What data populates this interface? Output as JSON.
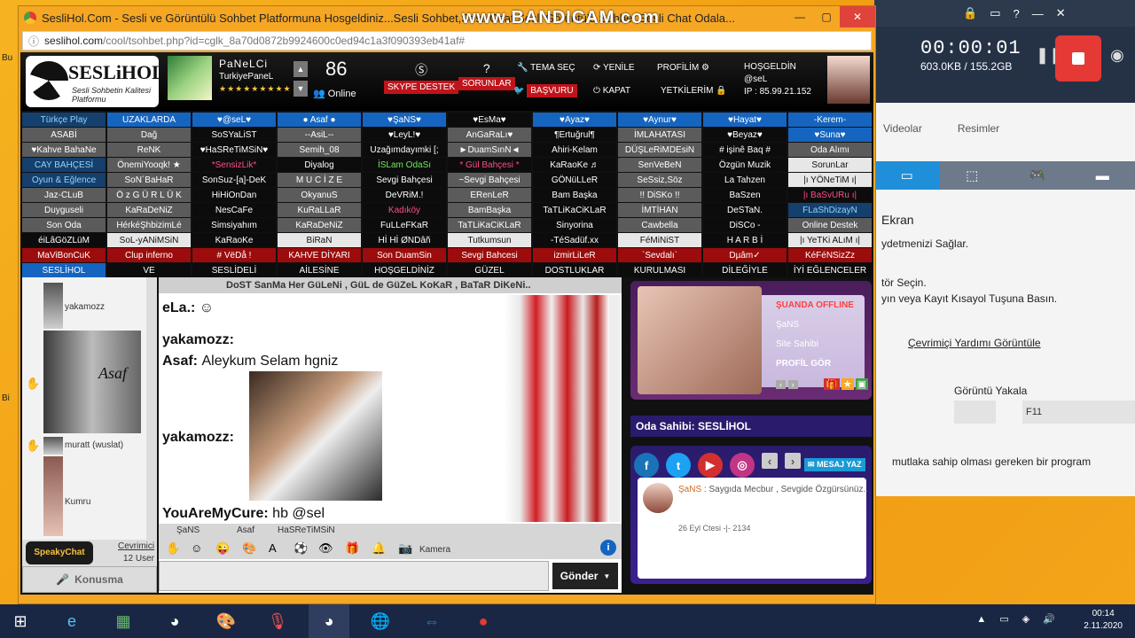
{
  "window": {
    "title": "SesliHol.Com - Sesli ve Görüntülü Sohbet Platformuna Hosgeldiniz...Sesli Sohbet,Sesli Chat,Sesli Görüntülü Sohbet,Sesli Chat Odala...",
    "watermark": "www.BANDICAM.com",
    "url_host": "seslihol.com",
    "url_path": "/cool/tsohbet.php?id=cglk_8a70d0872b9924600c0ed94c1a3f090393eb41af#"
  },
  "header": {
    "logo_title": "SESLiHOL",
    "logo_sub": "Sesli Sohbetin Kalitesi Platformu",
    "user_name": "PaNeLCi",
    "user_rank": "TurkiyePaneL",
    "user_stars": "★★★★★★★★★",
    "online_count": "86",
    "online_label": "Online",
    "skype": "SKYPE DESTEK",
    "sorunlar": "SORUNLAR",
    "tema": "TEMA SEÇ",
    "basvuru": "BAŞVURU",
    "yenile": "YENİLE",
    "kapat": "KAPAT",
    "profilim": "PROFİLİM",
    "yetkilerim": "YETKİLERİM",
    "hosgeldin": "HOŞGELDİN",
    "hosgeldin_user": "@seL",
    "ip": "IP : 85.99.21.152"
  },
  "rooms": [
    {
      "t": "Türkçe Play",
      "c": "teal"
    },
    {
      "t": "UZAKLARDA",
      "c": "blue"
    },
    {
      "t": "♥@seL♥",
      "c": "blue"
    },
    {
      "t": "● Asaf ●",
      "c": "blue"
    },
    {
      "t": "♥ŞaNS♥",
      "c": "blue"
    },
    {
      "t": "♥EsMa♥",
      "c": "dark"
    },
    {
      "t": "♥Ayaz♥",
      "c": "blue"
    },
    {
      "t": "♥Aynur♥",
      "c": "blue"
    },
    {
      "t": "♥Hayat♥",
      "c": "blue"
    },
    {
      "t": "-Kerem-",
      "c": "blue"
    },
    {
      "t": "ASABİ",
      "c": "gray"
    },
    {
      "t": "Dağ",
      "c": "gray"
    },
    {
      "t": "SoSYaLiST",
      "c": "dark"
    },
    {
      "t": "--AsiL--",
      "c": "gray"
    },
    {
      "t": "♥LeyL!♥",
      "c": "dark"
    },
    {
      "t": "AnGaRaLı♥",
      "c": "gray"
    },
    {
      "t": "¶Ertuğrul¶",
      "c": "dark"
    },
    {
      "t": "İMLAHATASI",
      "c": "gray"
    },
    {
      "t": "♥Beyaz♥",
      "c": "dark"
    },
    {
      "t": "♥Suna♥",
      "c": "blue"
    },
    {
      "t": "♥Kahve BahaNe",
      "c": "gray"
    },
    {
      "t": "ReNK",
      "c": "gray"
    },
    {
      "t": "♥HaSReTiMSiN♥",
      "c": "dark"
    },
    {
      "t": "Semih_08",
      "c": "gray"
    },
    {
      "t": "Uzağımdayımki [;",
      "c": "dark"
    },
    {
      "t": "►DuamSınN◄",
      "c": "gray"
    },
    {
      "t": "Ahiri-Kelam",
      "c": "dark"
    },
    {
      "t": "DÜŞLeRiMDEsiN",
      "c": "gray"
    },
    {
      "t": "# işinê Baq #",
      "c": "dark"
    },
    {
      "t": "Oda Alımı",
      "c": "gray"
    },
    {
      "t": "CAY BAHÇESİ",
      "c": "teal"
    },
    {
      "t": "ÖnemiYooqk! ★",
      "c": "gray"
    },
    {
      "t": "*SensizLik*",
      "c": "dark pink"
    },
    {
      "t": "Diyalog",
      "c": "dark"
    },
    {
      "t": "İSLam OdaSı",
      "c": "dark green"
    },
    {
      "t": "* Gül Bahçesi *",
      "c": "dark pink"
    },
    {
      "t": "KaRaoKe ♬",
      "c": "dark"
    },
    {
      "t": "SenVeBeN",
      "c": "gray"
    },
    {
      "t": "Özgün Muzik",
      "c": "dark"
    },
    {
      "t": "SorunLar",
      "c": "white"
    },
    {
      "t": "Oyun & Eğlence",
      "c": "teal"
    },
    {
      "t": "SoN´BaHaR",
      "c": "gray"
    },
    {
      "t": "SonSuz-[a]-DeK",
      "c": "dark"
    },
    {
      "t": "M U C İ Z E",
      "c": "gray"
    },
    {
      "t": "Sevgi Bahçesi",
      "c": "dark"
    },
    {
      "t": "~Sevgi Bahçesi",
      "c": "gray"
    },
    {
      "t": "GÖNüLLeR",
      "c": "dark"
    },
    {
      "t": "SeSsiz,Söz",
      "c": "gray"
    },
    {
      "t": "La Tahzen",
      "c": "dark"
    },
    {
      "t": "|ı YÖNeTiM ı|",
      "c": "white"
    },
    {
      "t": "Jaz-CLuB",
      "c": "gray"
    },
    {
      "t": "Ö z G Ü R L Ü K",
      "c": "gray"
    },
    {
      "t": "HiHiOnDan",
      "c": "dark"
    },
    {
      "t": "OkyanuS",
      "c": "gray"
    },
    {
      "t": "DeVRiM.!",
      "c": "dark"
    },
    {
      "t": "ERenLeR",
      "c": "gray"
    },
    {
      "t": "Bam Başka",
      "c": "dark"
    },
    {
      "t": "!! DiSKo !!",
      "c": "gray"
    },
    {
      "t": "BaSzen",
      "c": "dark"
    },
    {
      "t": "|ı BaSvURu ı|",
      "c": "dark pink"
    },
    {
      "t": "Duyguseli",
      "c": "gray"
    },
    {
      "t": "KaRaDeNiZ",
      "c": "gray"
    },
    {
      "t": "NesCaFe",
      "c": "dark"
    },
    {
      "t": "KuRaLLaR",
      "c": "gray"
    },
    {
      "t": "Kadıköy",
      "c": "dark pink"
    },
    {
      "t": "BamBaşka",
      "c": "gray"
    },
    {
      "t": "TaTLiKaCiKLaR",
      "c": "dark"
    },
    {
      "t": "İMTİHAN",
      "c": "gray"
    },
    {
      "t": "DeSTaN.",
      "c": "dark"
    },
    {
      "t": "FLaShDizayN",
      "c": "teal"
    },
    {
      "t": "Son Oda",
      "c": "gray"
    },
    {
      "t": "HérkéŞhbizimLé",
      "c": "gray"
    },
    {
      "t": "Simsiyahım",
      "c": "dark"
    },
    {
      "t": "KaRaDeNiZ",
      "c": "gray"
    },
    {
      "t": "FuLLeFKaR",
      "c": "dark"
    },
    {
      "t": "TaTLiKaCiKLaR",
      "c": "gray"
    },
    {
      "t": "Sinyorina",
      "c": "dark"
    },
    {
      "t": "Cawbella",
      "c": "gray"
    },
    {
      "t": "DiSCo -",
      "c": "dark"
    },
    {
      "t": "Online Destek",
      "c": "gray"
    },
    {
      "t": "éiLâGöZLüM",
      "c": "dark"
    },
    {
      "t": "SoL-yANiMSiN",
      "c": "white"
    },
    {
      "t": "KaRaoKe",
      "c": "dark"
    },
    {
      "t": "BiRaN",
      "c": "white"
    },
    {
      "t": "Hİ Hİ ØNDâñ",
      "c": "dark"
    },
    {
      "t": "Tutkumsun",
      "c": "white"
    },
    {
      "t": "-TéSadüf.xx",
      "c": "dark"
    },
    {
      "t": "FéMiNiST",
      "c": "white"
    },
    {
      "t": "H A R B İ",
      "c": "dark"
    },
    {
      "t": "|ı YeTKi ALıM ı|",
      "c": "white"
    },
    {
      "t": "MaViBonCuK",
      "c": "red"
    },
    {
      "t": "Clup inferno",
      "c": "red"
    },
    {
      "t": "# VëDå !",
      "c": "red"
    },
    {
      "t": "KAHVE DİYARI",
      "c": "red"
    },
    {
      "t": "Son DuamSin",
      "c": "red"
    },
    {
      "t": "Sevgi Bahcesi",
      "c": "red"
    },
    {
      "t": "izmirLiLeR",
      "c": "red"
    },
    {
      "t": "`Sevdalı`",
      "c": "red"
    },
    {
      "t": "Dµâm✓",
      "c": "red"
    },
    {
      "t": "KéFéNSizZz",
      "c": "red"
    },
    {
      "t": "SESLİHOL",
      "c": "blue"
    },
    {
      "t": "VE",
      "c": "dark"
    },
    {
      "t": "SESLİDELİ",
      "c": "dark"
    },
    {
      "t": "AİLESİNE",
      "c": "dark"
    },
    {
      "t": "HOŞGELDİNİZ",
      "c": "dark"
    },
    {
      "t": "GÜZEL",
      "c": "dark"
    },
    {
      "t": "DOSTLUKLAR",
      "c": "dark"
    },
    {
      "t": "KURULMASI",
      "c": "dark"
    },
    {
      "t": "DİLEĞİYLE",
      "c": "dark"
    },
    {
      "t": "İYİ EĞLENCELER",
      "c": "dark"
    }
  ],
  "users": [
    {
      "name": "yakamozz"
    },
    {
      "name": "Asaf"
    },
    {
      "name": "muratt (wuslat)"
    },
    {
      "name": "Kumru"
    }
  ],
  "users_footer": {
    "logo": "SpeakyChat",
    "cevrimici": "Cevrimici",
    "count": "12 User",
    "konusma": "Konusma"
  },
  "chat": {
    "topic": "DoST SanMa Her GüLeNi , GüL de GüZeL KoKaR , BaTaR DiKeNi..",
    "messages": [
      {
        "nick": "eLa.:",
        "text": "☺"
      },
      {
        "nick": "yakamozz:",
        "text": ""
      },
      {
        "nick": "Asaf:",
        "text": "Aleykum Selam hgniz"
      },
      {
        "nick": "yakamozz:",
        "text": ""
      },
      {
        "nick": "YouAreMyCure:",
        "text": "hb @sel"
      }
    ],
    "toolbar_names": [
      "ŞaNS",
      "Asaf",
      "HaSReTiMSiN"
    ],
    "kamera": "Kamera",
    "send": "Gönder"
  },
  "profile": {
    "status": "ŞUANDA OFFLINE",
    "name": "ŞaNS",
    "role": "Site Sahibi",
    "profil": "PROFİL GÖR",
    "owner": "Oda Sahibi: SESLİHOL",
    "mesaj": "MESAJ YAZ",
    "card_name": "ŞaNS",
    "card_text": "Saygıda Mecbur , Sevgide Özgürsünüz..",
    "card_date": "26 Eyl Ctesi -|- 2134"
  },
  "bandicam": {
    "time": "00:00:01",
    "size": "603.0KB / 155.2GB",
    "tab_videos": "Videolar",
    "tab_images": "Resimler",
    "screen": "Ekran",
    "desc1": "ydetmenizi Sağlar.",
    "desc2": "tör Seçin.",
    "desc3": "yın veya Kayıt Kısayol Tuşuna Basın.",
    "help": "Çevrimiçi Yardımı Görüntüle",
    "capture": "Görüntü Yakala",
    "key": "F11",
    "footer": "mutlaka sahip olması gereken bir program"
  },
  "taskbar": {
    "time": "00:14",
    "date": "2.11.2020"
  }
}
